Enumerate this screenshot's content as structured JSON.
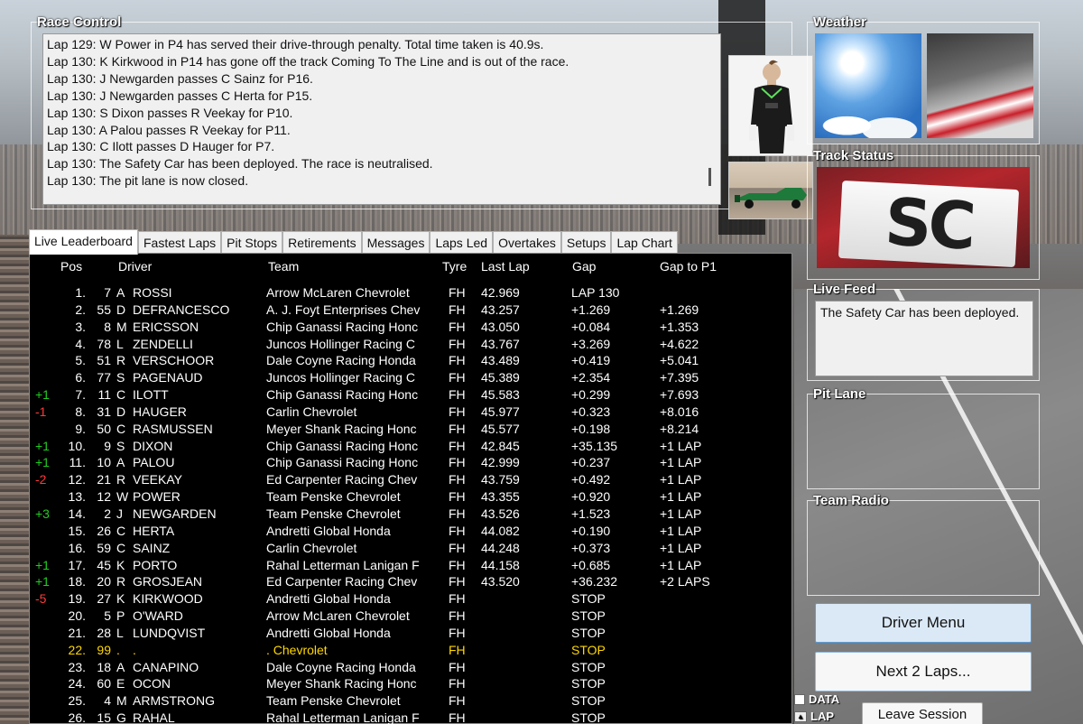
{
  "race_control": {
    "title": "Race Control",
    "messages": [
      "Lap 129: W Power in P4 has served their drive-through penalty. Total time taken is 40.9s.",
      "Lap 130: K Kirkwood in P14 has gone off the track Coming To The Line and is out of the race.",
      "Lap 130: J Newgarden passes C Sainz for P16.",
      "Lap 130: J Newgarden passes C Herta for P15.",
      "Lap 130: S Dixon passes R Veekay for P10.",
      "Lap 130: A Palou passes R Veekay for P11.",
      "Lap 130: C Ilott passes D Hauger for P7.",
      "Lap 130: The Safety Car has been deployed. The race is neutralised.",
      "Lap 130: The pit lane is now closed."
    ]
  },
  "weather": {
    "title": "Weather"
  },
  "track_status": {
    "title": "Track Status",
    "sign": "SC"
  },
  "live_feed": {
    "title": "Live Feed",
    "text": "The Safety Car has been deployed."
  },
  "pit_lane": {
    "title": "Pit Lane"
  },
  "team_radio": {
    "title": "Team Radio"
  },
  "tabs": [
    "Live Leaderboard",
    "Fastest Laps",
    "Pit Stops",
    "Retirements",
    "Messages",
    "Laps Led",
    "Overtakes",
    "Setups",
    "Lap Chart"
  ],
  "leaderboard": {
    "headers": {
      "pos": "Pos",
      "driver": "Driver",
      "team": "Team",
      "tyre": "Tyre",
      "last": "Last Lap",
      "gap": "Gap",
      "gapp1": "Gap to P1"
    },
    "rows": [
      {
        "chg": "",
        "pos": "1.",
        "num": "7",
        "ini": "A",
        "name": "ROSSI",
        "team": "Arrow McLaren Chevrolet",
        "tyre": "FH",
        "last": "42.969",
        "gap": "LAP 130",
        "gapp1": ""
      },
      {
        "chg": "",
        "pos": "2.",
        "num": "55",
        "ini": "D",
        "name": "DEFRANCESCO",
        "team": "A. J. Foyt Enterprises Chev",
        "tyre": "FH",
        "last": "43.257",
        "gap": "+1.269",
        "gapp1": "+1.269"
      },
      {
        "chg": "",
        "pos": "3.",
        "num": "8",
        "ini": "M",
        "name": "ERICSSON",
        "team": "Chip Ganassi Racing Honc",
        "tyre": "FH",
        "last": "43.050",
        "gap": "+0.084",
        "gapp1": "+1.353"
      },
      {
        "chg": "",
        "pos": "4.",
        "num": "78",
        "ini": "L",
        "name": "ZENDELLI",
        "team": "Juncos Hollinger Racing C",
        "tyre": "FH",
        "last": "43.767",
        "gap": "+3.269",
        "gapp1": "+4.622"
      },
      {
        "chg": "",
        "pos": "5.",
        "num": "51",
        "ini": "R",
        "name": "VERSCHOOR",
        "team": "Dale Coyne Racing Honda",
        "tyre": "FH",
        "last": "43.489",
        "gap": "+0.419",
        "gapp1": "+5.041"
      },
      {
        "chg": "",
        "pos": "6.",
        "num": "77",
        "ini": "S",
        "name": "PAGENAUD",
        "team": "Juncos Hollinger Racing C",
        "tyre": "FH",
        "last": "45.389",
        "gap": "+2.354",
        "gapp1": "+7.395"
      },
      {
        "chg": "+1",
        "pos": "7.",
        "num": "11",
        "ini": "C",
        "name": "ILOTT",
        "team": "Chip Ganassi Racing Honc",
        "tyre": "FH",
        "last": "45.583",
        "gap": "+0.299",
        "gapp1": "+7.693"
      },
      {
        "chg": "-1",
        "pos": "8.",
        "num": "31",
        "ini": "D",
        "name": "HAUGER",
        "team": "Carlin Chevrolet",
        "tyre": "FH",
        "last": "45.977",
        "gap": "+0.323",
        "gapp1": "+8.016"
      },
      {
        "chg": "",
        "pos": "9.",
        "num": "50",
        "ini": "C",
        "name": "RASMUSSEN",
        "team": "Meyer Shank Racing Honc",
        "tyre": "FH",
        "last": "45.577",
        "gap": "+0.198",
        "gapp1": "+8.214"
      },
      {
        "chg": "+1",
        "pos": "10.",
        "num": "9",
        "ini": "S",
        "name": "DIXON",
        "team": "Chip Ganassi Racing Honc",
        "tyre": "FH",
        "last": "42.845",
        "gap": "+35.135",
        "gapp1": "+1 LAP"
      },
      {
        "chg": "+1",
        "pos": "11.",
        "num": "10",
        "ini": "A",
        "name": "PALOU",
        "team": "Chip Ganassi Racing Honc",
        "tyre": "FH",
        "last": "42.999",
        "gap": "+0.237",
        "gapp1": "+1 LAP"
      },
      {
        "chg": "-2",
        "pos": "12.",
        "num": "21",
        "ini": "R",
        "name": "VEEKAY",
        "team": "Ed Carpenter Racing Chev",
        "tyre": "FH",
        "last": "43.759",
        "gap": "+0.492",
        "gapp1": "+1 LAP"
      },
      {
        "chg": "",
        "pos": "13.",
        "num": "12",
        "ini": "W",
        "name": "POWER",
        "team": "Team Penske Chevrolet",
        "tyre": "FH",
        "last": "43.355",
        "gap": "+0.920",
        "gapp1": "+1 LAP"
      },
      {
        "chg": "+3",
        "pos": "14.",
        "num": "2",
        "ini": "J",
        "name": "NEWGARDEN",
        "team": "Team Penske Chevrolet",
        "tyre": "FH",
        "last": "43.526",
        "gap": "+1.523",
        "gapp1": "+1 LAP"
      },
      {
        "chg": "",
        "pos": "15.",
        "num": "26",
        "ini": "C",
        "name": "HERTA",
        "team": "Andretti Global Honda",
        "tyre": "FH",
        "last": "44.082",
        "gap": "+0.190",
        "gapp1": "+1 LAP"
      },
      {
        "chg": "",
        "pos": "16.",
        "num": "59",
        "ini": "C",
        "name": "SAINZ",
        "team": "Carlin Chevrolet",
        "tyre": "FH",
        "last": "44.248",
        "gap": "+0.373",
        "gapp1": "+1 LAP"
      },
      {
        "chg": "+1",
        "pos": "17.",
        "num": "45",
        "ini": "K",
        "name": "PORTO",
        "team": "Rahal Letterman Lanigan F",
        "tyre": "FH",
        "last": "44.158",
        "gap": "+0.685",
        "gapp1": "+1 LAP"
      },
      {
        "chg": "+1",
        "pos": "18.",
        "num": "20",
        "ini": "R",
        "name": "GROSJEAN",
        "team": "Ed Carpenter Racing Chev",
        "tyre": "FH",
        "last": "43.520",
        "gap": "+36.232",
        "gapp1": "+2 LAPS"
      },
      {
        "chg": "-5",
        "pos": "19.",
        "num": "27",
        "ini": "K",
        "name": "KIRKWOOD",
        "team": "Andretti Global Honda",
        "tyre": "FH",
        "last": "",
        "gap": "STOP",
        "gapp1": ""
      },
      {
        "chg": "",
        "pos": "20.",
        "num": "5",
        "ini": "P",
        "name": "O'WARD",
        "team": "Arrow McLaren Chevrolet",
        "tyre": "FH",
        "last": "",
        "gap": "STOP",
        "gapp1": ""
      },
      {
        "chg": "",
        "pos": "21.",
        "num": "28",
        "ini": "L",
        "name": "LUNDQVIST",
        "team": "Andretti Global Honda",
        "tyre": "FH",
        "last": "",
        "gap": "STOP",
        "gapp1": ""
      },
      {
        "chg": "",
        "pos": "22.",
        "num": "99",
        "ini": ".",
        "name": ".",
        "team": ". Chevrolet",
        "tyre": "FH",
        "last": "",
        "gap": "STOP",
        "gapp1": "",
        "highlight": true
      },
      {
        "chg": "",
        "pos": "23.",
        "num": "18",
        "ini": "A",
        "name": "CANAPINO",
        "team": "Dale Coyne Racing Honda",
        "tyre": "FH",
        "last": "",
        "gap": "STOP",
        "gapp1": ""
      },
      {
        "chg": "",
        "pos": "24.",
        "num": "60",
        "ini": "E",
        "name": "OCON",
        "team": "Meyer Shank Racing Honc",
        "tyre": "FH",
        "last": "",
        "gap": "STOP",
        "gapp1": ""
      },
      {
        "chg": "",
        "pos": "25.",
        "num": "4",
        "ini": "M",
        "name": "ARMSTRONG",
        "team": "Team Penske Chevrolet",
        "tyre": "FH",
        "last": "",
        "gap": "STOP",
        "gapp1": ""
      },
      {
        "chg": "",
        "pos": "26.",
        "num": "15",
        "ini": "G",
        "name": "RAHAL",
        "team": "Rahal Letterman Lanigan F",
        "tyre": "FH",
        "last": "",
        "gap": "STOP",
        "gapp1": ""
      }
    ]
  },
  "buttons": {
    "driver_menu": "Driver Menu",
    "next_laps": "Next 2 Laps...",
    "leave_session": "Leave Session"
  },
  "options": {
    "data_label": "DATA",
    "lap_label": "LAP"
  },
  "colors": {
    "gain": "#22cc22",
    "loss": "#ff3a3a",
    "highlight": "#ffd700"
  }
}
